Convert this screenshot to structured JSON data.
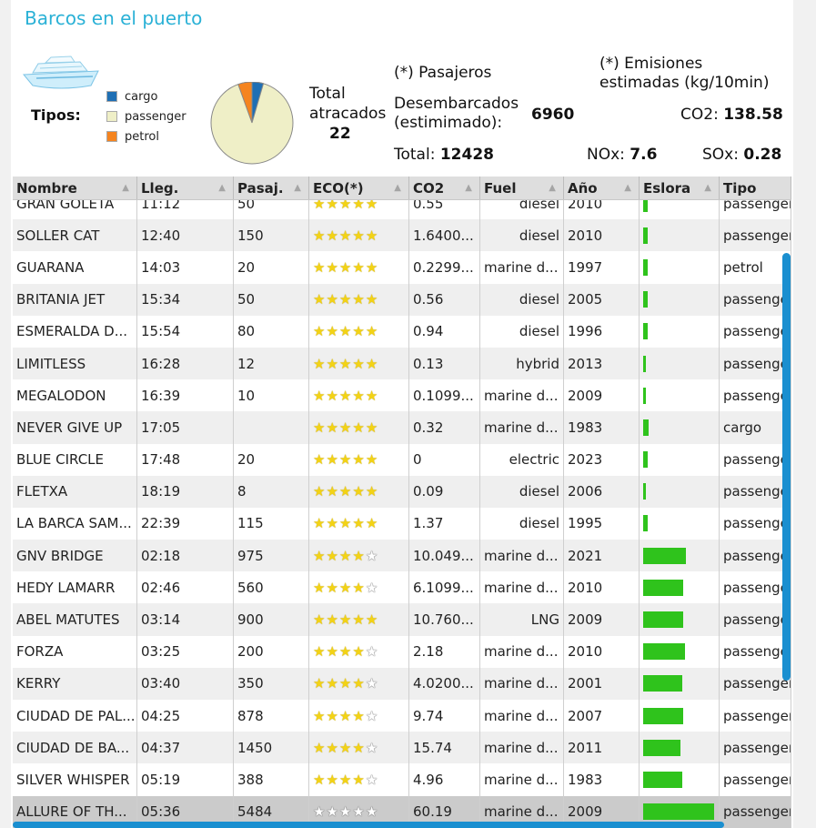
{
  "title": "Barcos en el puerto",
  "tipos_label": "Tipos:",
  "legend": [
    {
      "label": "cargo",
      "color": "#1f6fb4"
    },
    {
      "label": "passenger",
      "color": "#efefc7"
    },
    {
      "label": "petrol",
      "color": "#f5841f"
    }
  ],
  "pie_shares": {
    "cargo": 0.045,
    "passenger": 0.9,
    "petrol": 0.055
  },
  "atracados": {
    "label1": "Total",
    "label2": "atracados",
    "value": "22"
  },
  "pasajeros": {
    "header": "(*) Pasajeros",
    "desemb_label1": "Desembarcados",
    "desemb_label2": "(estimimado):",
    "desemb_value": "6960",
    "total_label": "Total:",
    "total_value": "12428"
  },
  "emisiones": {
    "header1": "(*) Emisiones",
    "header2": "estimadas (kg/10min)",
    "co2_label": "CO2:",
    "co2_value": "138.58",
    "nox_label": "NOx:",
    "nox_value": "7.6",
    "sox_label": "SOx:",
    "sox_value": "0.28"
  },
  "columns": [
    "Nombre",
    "Lleg.",
    "Pasaj.",
    "ECO(*)",
    "CO2",
    "Fuel",
    "Año",
    "Eslora",
    "Tipo"
  ],
  "rows": [
    {
      "nombre": "GRAN GOLETA",
      "lleg": "11:12",
      "pasaj": "50",
      "eco": 5,
      "co2": "0.55",
      "fuel": "diesel",
      "anio": "2010",
      "eslora": 0.07,
      "tipo": "passenger"
    },
    {
      "nombre": "SOLLER CAT",
      "lleg": "12:40",
      "pasaj": "150",
      "eco": 5,
      "co2": "1.6400...",
      "fuel": "diesel",
      "anio": "2010",
      "eslora": 0.07,
      "tipo": "passenger"
    },
    {
      "nombre": "GUARANA",
      "lleg": "14:03",
      "pasaj": "20",
      "eco": 5,
      "co2": "0.2299...",
      "fuel": "marine d...",
      "anio": "1997",
      "eslora": 0.07,
      "tipo": "petrol"
    },
    {
      "nombre": "BRITANIA JET",
      "lleg": "15:34",
      "pasaj": "50",
      "eco": 5,
      "co2": "0.56",
      "fuel": "diesel",
      "anio": "2005",
      "eslora": 0.07,
      "tipo": "passenger"
    },
    {
      "nombre": "ESMERALDA D...",
      "lleg": "15:54",
      "pasaj": "80",
      "eco": 5,
      "co2": "0.94",
      "fuel": "diesel",
      "anio": "1996",
      "eslora": 0.06,
      "tipo": "passenger"
    },
    {
      "nombre": "LIMITLESS",
      "lleg": "16:28",
      "pasaj": "12",
      "eco": 5,
      "co2": "0.13",
      "fuel": "hybrid",
      "anio": "2013",
      "eslora": 0.04,
      "tipo": "passenger"
    },
    {
      "nombre": "MEGALODON",
      "lleg": "16:39",
      "pasaj": "10",
      "eco": 5,
      "co2": "0.1099...",
      "fuel": "marine d...",
      "anio": "2009",
      "eslora": 0.04,
      "tipo": "passenger"
    },
    {
      "nombre": "NEVER GIVE UP",
      "lleg": "17:05",
      "pasaj": "",
      "eco": 5,
      "co2": "0.32",
      "fuel": "marine d...",
      "anio": "1983",
      "eslora": 0.08,
      "tipo": "cargo"
    },
    {
      "nombre": "BLUE CIRCLE",
      "lleg": "17:48",
      "pasaj": "20",
      "eco": 5,
      "co2": "0",
      "fuel": "electric",
      "anio": "2023",
      "eslora": 0.07,
      "tipo": "passenger"
    },
    {
      "nombre": "FLETXA",
      "lleg": "18:19",
      "pasaj": "8",
      "eco": 5,
      "co2": "0.09",
      "fuel": "diesel",
      "anio": "2006",
      "eslora": 0.03,
      "tipo": "passenger"
    },
    {
      "nombre": "LA BARCA SAM...",
      "lleg": "22:39",
      "pasaj": "115",
      "eco": 5,
      "co2": "1.37",
      "fuel": "diesel",
      "anio": "1995",
      "eslora": 0.07,
      "tipo": "passenger"
    },
    {
      "nombre": "GNV BRIDGE",
      "lleg": "02:18",
      "pasaj": "975",
      "eco": 4,
      "co2": "10.049...",
      "fuel": "marine d...",
      "anio": "2021",
      "eslora": 0.6,
      "tipo": "passenger"
    },
    {
      "nombre": "HEDY LAMARR",
      "lleg": "02:46",
      "pasaj": "560",
      "eco": 4,
      "co2": "6.1099...",
      "fuel": "marine d...",
      "anio": "2010",
      "eslora": 0.57,
      "tipo": "passenger"
    },
    {
      "nombre": "ABEL MATUTES",
      "lleg": "03:14",
      "pasaj": "900",
      "eco": 5,
      "co2": "10.760...",
      "fuel": "LNG",
      "anio": "2009",
      "eslora": 0.57,
      "tipo": "passenger"
    },
    {
      "nombre": "FORZA",
      "lleg": "03:25",
      "pasaj": "200",
      "eco": 4,
      "co2": "2.18",
      "fuel": "marine d...",
      "anio": "2010",
      "eslora": 0.59,
      "tipo": "passenger"
    },
    {
      "nombre": "KERRY",
      "lleg": "03:40",
      "pasaj": "350",
      "eco": 4,
      "co2": "4.0200...",
      "fuel": "marine d...",
      "anio": "2001",
      "eslora": 0.55,
      "tipo": "passenger"
    },
    {
      "nombre": "CIUDAD DE PAL...",
      "lleg": "04:25",
      "pasaj": "878",
      "eco": 4,
      "co2": "9.74",
      "fuel": "marine d...",
      "anio": "2007",
      "eslora": 0.57,
      "tipo": "passenger"
    },
    {
      "nombre": "CIUDAD DE BA...",
      "lleg": "04:37",
      "pasaj": "1450",
      "eco": 4,
      "co2": "15.74",
      "fuel": "marine d...",
      "anio": "2011",
      "eslora": 0.53,
      "tipo": "passenger"
    },
    {
      "nombre": "SILVER WHISPER",
      "lleg": "05:19",
      "pasaj": "388",
      "eco": 4,
      "co2": "4.96",
      "fuel": "marine d...",
      "anio": "1983",
      "eslora": 0.55,
      "tipo": "passenger"
    },
    {
      "nombre": "ALLURE OF TH...",
      "lleg": "05:36",
      "pasaj": "5484",
      "eco": 0,
      "co2": "60.19",
      "fuel": "marine d...",
      "anio": "2009",
      "eslora": 1.0,
      "tipo": "passenger"
    }
  ]
}
